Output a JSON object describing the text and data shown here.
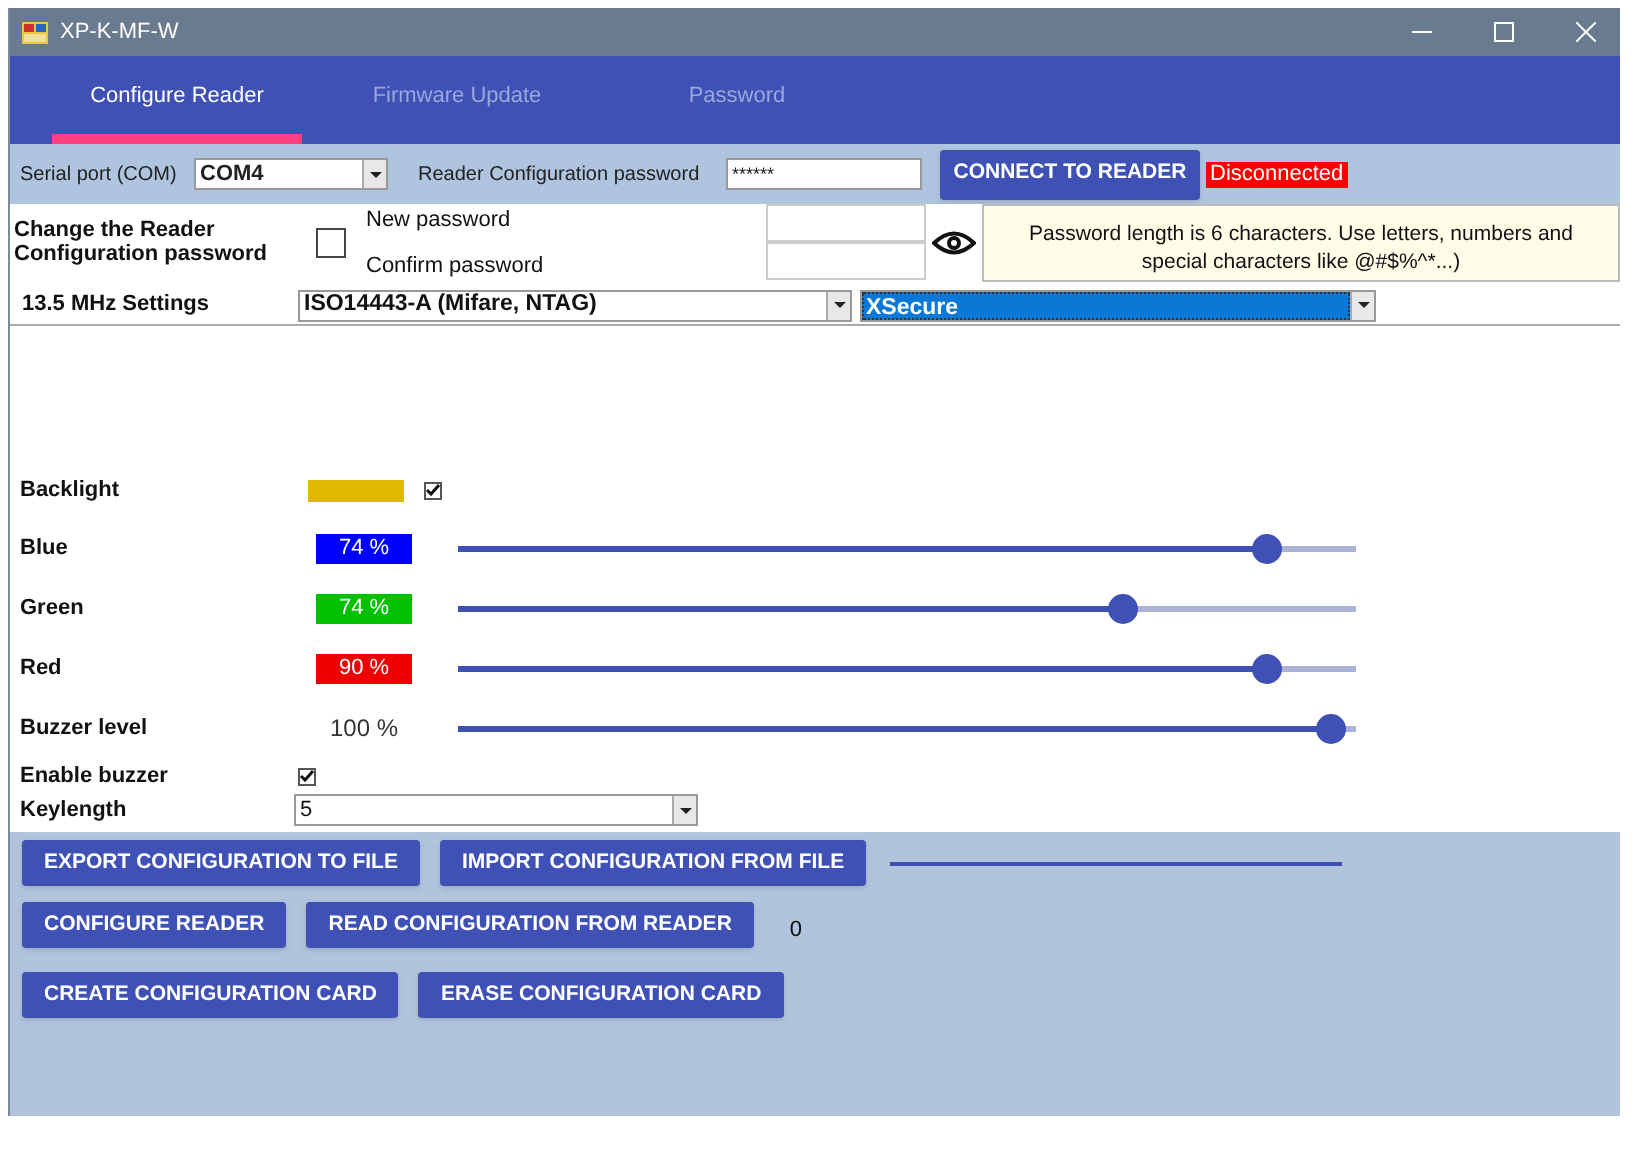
{
  "window": {
    "title": "XP-K-MF-W"
  },
  "tabs": [
    {
      "label": "Configure Reader",
      "selected": true
    },
    {
      "label": "Firmware Update",
      "selected": false
    },
    {
      "label": "Password",
      "selected": false
    }
  ],
  "connection": {
    "serial_port_label": "Serial port (COM)",
    "serial_port": "COM4",
    "password_label": "Reader Configuration password",
    "password": "******",
    "connect_button": "CONNECT TO READER",
    "status": "Disconnected"
  },
  "change_password": {
    "label": "Change the Reader Configuration password",
    "checked": false,
    "new_label": "New password",
    "confirm_label": "Confirm password",
    "hint": "Password length is 6 characters. Use letters, numbers and special characters like @#$%^*...)"
  },
  "settings": {
    "label": "13.5 MHz Settings",
    "protocol": "ISO14443-A (Mifare, NTAG)",
    "security": "XSecure"
  },
  "backlight": {
    "label": "Backlight",
    "color": "#e0b800",
    "checked": true
  },
  "channels": [
    {
      "kind": "color",
      "name": "Blue",
      "color": "#0000ff",
      "reading": "74 %",
      "level": 0.9
    },
    {
      "kind": "color",
      "name": "Green",
      "color": "#00c000",
      "reading": "74 %",
      "level": 0.74
    },
    {
      "kind": "color",
      "name": "Red",
      "color": "#ee0000",
      "reading": "90 %",
      "level": 0.9
    },
    {
      "kind": "plain",
      "name": "Buzzer level",
      "reading": "100 %",
      "level": 0.97
    }
  ],
  "enable_buzzer": {
    "label": "Enable buzzer",
    "checked": true
  },
  "keylength": {
    "label": "Keylength",
    "value": "5"
  },
  "action_rows": [
    {
      "buttons": [
        "EXPORT CONFIGURATION TO FILE",
        "IMPORT CONFIGURATION FROM FILE"
      ],
      "progress": {
        "level": 1
      }
    },
    {
      "buttons": [
        "CONFIGURE READER",
        "READ CONFIGURATION FROM READER"
      ],
      "counter": "0"
    },
    {
      "buttons": [
        "CREATE CONFIGURATION CARD",
        "ERASE CONFIGURATION CARD"
      ]
    }
  ]
}
